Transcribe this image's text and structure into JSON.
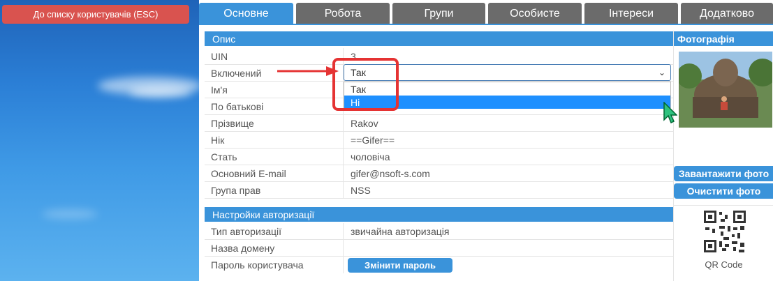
{
  "back_button": {
    "label": "До списку користувачів (ESC)"
  },
  "tabs": [
    {
      "label": "Основне",
      "active": true
    },
    {
      "label": "Робота",
      "active": false
    },
    {
      "label": "Групи",
      "active": false
    },
    {
      "label": "Особисте",
      "active": false
    },
    {
      "label": "Інтереси",
      "active": false
    },
    {
      "label": "Додатково",
      "active": false
    }
  ],
  "description": {
    "title": "Опис",
    "rows": [
      {
        "label": "UIN",
        "value": "3"
      },
      {
        "label": "Включений",
        "value": ""
      },
      {
        "label": "Ім'я",
        "value": ""
      },
      {
        "label": "По батькові",
        "value": ""
      },
      {
        "label": "Прізвище",
        "value": "Rakov"
      },
      {
        "label": "Нік",
        "value": "==Gifer=="
      },
      {
        "label": "Стать",
        "value": "чоловіча"
      },
      {
        "label": "Основний E-mail",
        "value": "gifer@nsoft-s.com"
      },
      {
        "label": "Група прав",
        "value": "NSS"
      }
    ]
  },
  "enabled_select": {
    "value": "Так",
    "options": [
      {
        "label": "Так",
        "highlighted": false
      },
      {
        "label": "Ні",
        "highlighted": true
      }
    ]
  },
  "photo": {
    "title": "Фотографія",
    "upload_label": "Завантажити фото",
    "clear_label": "Очистити фото"
  },
  "auth": {
    "title": "Настройки авторизації",
    "rows": [
      {
        "label": "Тип авторизації",
        "value": "звичайна авторизація"
      },
      {
        "label": "Назва домену",
        "value": ""
      },
      {
        "label": "Пароль користувача",
        "value": ""
      }
    ],
    "change_password_label": "Змінити пароль"
  },
  "qr": {
    "label": "QR Code"
  },
  "colors": {
    "accent": "#3a93da",
    "tab_inactive": "#6b6b6b",
    "danger": "#d9534f",
    "annotation": "#e53333",
    "highlight": "#1e90ff"
  }
}
